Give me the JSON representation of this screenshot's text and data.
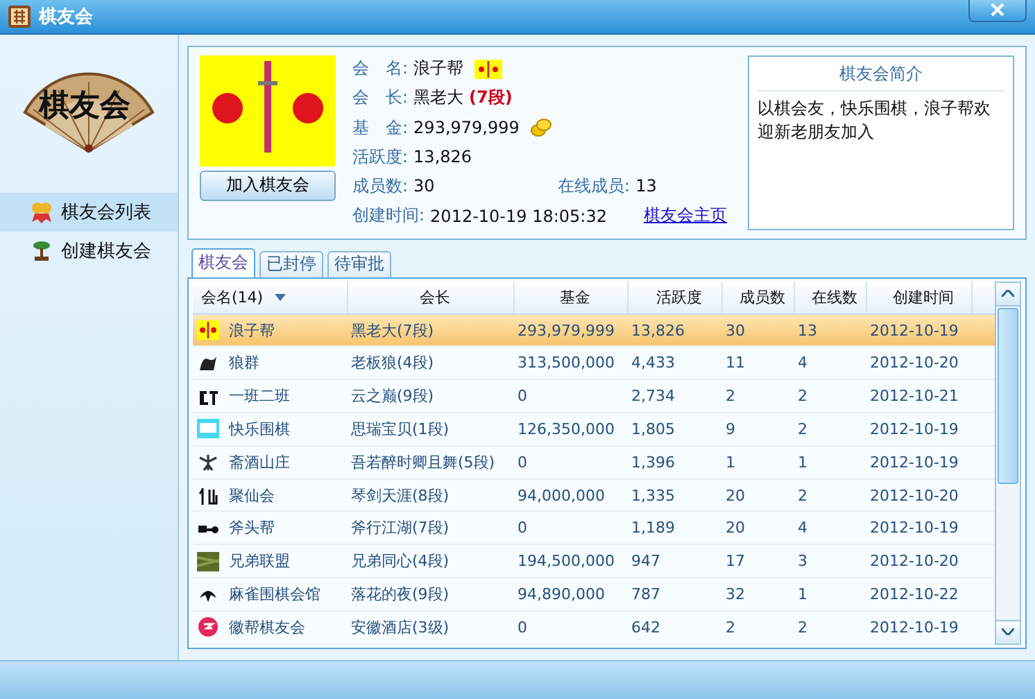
{
  "window": {
    "title": "棋友会"
  },
  "sidebar": {
    "logo": "棋友会",
    "items": [
      {
        "label": "棋友会列表",
        "selected": true
      },
      {
        "label": "创建棋友会",
        "selected": false
      }
    ]
  },
  "club": {
    "join_button": "加入棋友会",
    "fields": [
      {
        "label": "会　名:",
        "value": "浪子帮"
      },
      {
        "label": "会　长:",
        "value": "黑老大",
        "extra": "(7段)"
      },
      {
        "label": "基　金:",
        "value": "293,979,999"
      },
      {
        "label": "活跃度:",
        "value": "13,826"
      }
    ],
    "members_label": "成员数:",
    "members": "30",
    "online_label": "在线成员:",
    "online": "13",
    "created_label": "创建时间:",
    "created": "2012-10-19 18:05:32",
    "homepage_link": "棋友会主页",
    "intro_title": "棋友会简介",
    "intro": "以棋会友，快乐围棋，浪子帮欢迎新老朋友加入"
  },
  "tabs": [
    {
      "label": "棋友会",
      "selected": true
    },
    {
      "label": "已封停",
      "selected": false
    },
    {
      "label": "待审批",
      "selected": false
    }
  ],
  "table": {
    "columns": [
      {
        "label": "会名(14)",
        "sorted": true
      },
      {
        "label": "会长",
        "sorted": false
      },
      {
        "label": "基金",
        "sorted": false
      },
      {
        "label": "活跃度",
        "sorted": false
      },
      {
        "label": "成员数",
        "sorted": false
      },
      {
        "label": "在线数",
        "sorted": false
      },
      {
        "label": "创建时间",
        "sorted": false
      }
    ],
    "rows": [
      {
        "cells": [
          "浪子帮",
          "黑老大(7段)",
          "293,979,999",
          "13,826",
          "30",
          "13",
          "2012-10-19"
        ],
        "selected": true
      },
      {
        "cells": [
          "狼群",
          "老板狼(4段)",
          "313,500,000",
          "4,433",
          "11",
          "4",
          "2012-10-20"
        ],
        "selected": false
      },
      {
        "cells": [
          "一班二班",
          "云之巅(9段)",
          "0",
          "2,734",
          "2",
          "2",
          "2012-10-21"
        ],
        "selected": false
      },
      {
        "cells": [
          "快乐围棋",
          "思瑞宝贝(1段)",
          "126,350,000",
          "1,805",
          "9",
          "2",
          "2012-10-19"
        ],
        "selected": false
      },
      {
        "cells": [
          "斋酒山庄",
          "吾若醉时卿且舞(5段)",
          "0",
          "1,396",
          "1",
          "1",
          "2012-10-19"
        ],
        "selected": false
      },
      {
        "cells": [
          "聚仙会",
          "琴剑天涯(8段)",
          "94,000,000",
          "1,335",
          "20",
          "2",
          "2012-10-20"
        ],
        "selected": false
      },
      {
        "cells": [
          "斧头帮",
          "斧行江湖(7段)",
          "0",
          "1,189",
          "20",
          "4",
          "2012-10-19"
        ],
        "selected": false
      },
      {
        "cells": [
          "兄弟联盟",
          "兄弟同心(4段)",
          "194,500,000",
          "947",
          "17",
          "3",
          "2012-10-20"
        ],
        "selected": false
      },
      {
        "cells": [
          "麻雀围棋会馆",
          "落花的夜(9段)",
          "94,890,000",
          "787",
          "32",
          "1",
          "2012-10-22"
        ],
        "selected": false
      },
      {
        "cells": [
          "徽帮棋友会",
          "安徽酒店(3级)",
          "0",
          "642",
          "2",
          "2",
          "2012-10-19"
        ],
        "selected": false
      }
    ]
  }
}
